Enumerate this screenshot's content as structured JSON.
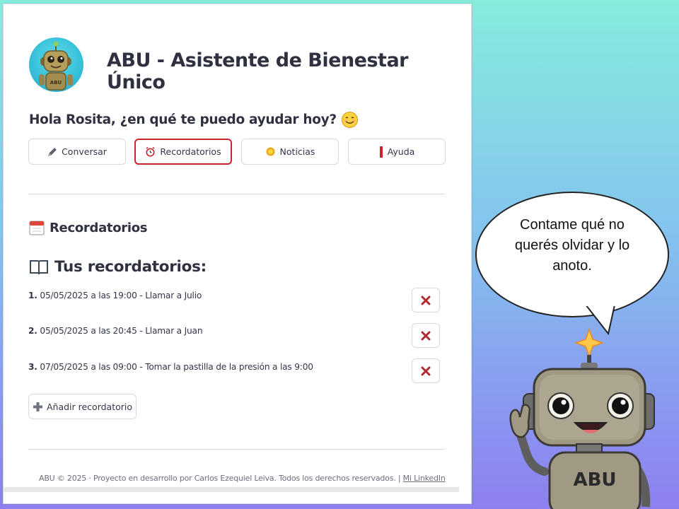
{
  "app": {
    "title": "ABU - Asistente de Bienestar Único",
    "logo_label": "ABU",
    "greeting": "Hola Rosita, ¿en qué te puedo ayudar hoy?"
  },
  "nav": {
    "items": [
      {
        "label": "Conversar",
        "icon": "pencil-icon"
      },
      {
        "label": "Recordatorios",
        "icon": "alarm-clock-icon",
        "active": true
      },
      {
        "label": "Noticias",
        "icon": "sun-icon"
      },
      {
        "label": "Ayuda",
        "icon": "red-bar-icon"
      }
    ]
  },
  "section": {
    "title": "Recordatorios",
    "subtitle": "Tus recordatorios:"
  },
  "reminders": [
    {
      "num": "1.",
      "text": "05/05/2025 a las 19:00 - Llamar a Julio"
    },
    {
      "num": "2.",
      "text": "05/05/2025 a las 20:45 - Llamar a Juan"
    },
    {
      "num": "3.",
      "text": "07/05/2025 a las 09:00 - Tomar la pastilla de la presión a las 9:00"
    }
  ],
  "add_button": {
    "label": "Añadir recordatorio"
  },
  "footer": {
    "text": "ABU © 2025 · Proyecto en desarrollo por Carlos Ezequiel Leiva. Todos los derechos reservados. |",
    "link": "Mi LinkedIn"
  },
  "bubble": {
    "text": "Contame qué no querés olvidar y lo anoto."
  },
  "mascot": {
    "label": "ABU"
  },
  "colors": {
    "accent": "#c9252b",
    "text": "#2f3140",
    "delete": "#b3282d"
  }
}
